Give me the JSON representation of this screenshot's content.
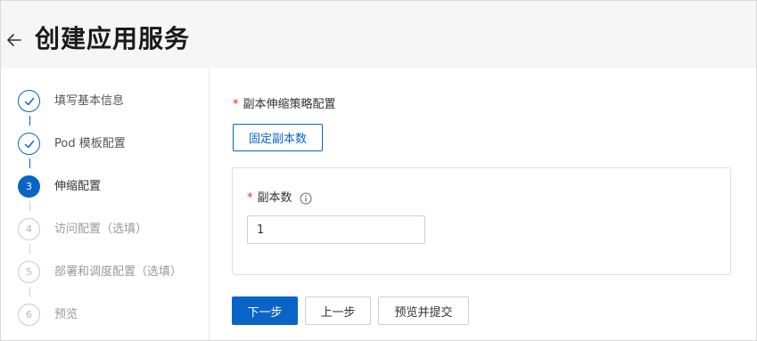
{
  "header": {
    "title": "创建应用服务"
  },
  "steps": [
    {
      "number": "1",
      "label": "填写基本信息",
      "state": "done"
    },
    {
      "number": "2",
      "label": "Pod 模板配置",
      "state": "done"
    },
    {
      "number": "3",
      "label": "伸缩配置",
      "state": "active"
    },
    {
      "number": "4",
      "label": "访问配置（选填）",
      "state": "todo"
    },
    {
      "number": "5",
      "label": "部署和调度配置（选填）",
      "state": "todo"
    },
    {
      "number": "6",
      "label": "预览",
      "state": "todo"
    }
  ],
  "scaling": {
    "required_mark": "*",
    "section_title": "副本伸缩策略配置",
    "policy_option": "固定副本数",
    "replicas_label": "副本数",
    "replicas_value": "1"
  },
  "actions": {
    "next": "下一步",
    "prev": "上一步",
    "preview_submit": "预览并提交"
  },
  "colors": {
    "accent": "#0a64c8",
    "required": "#d93026"
  },
  "icons": {
    "back": "arrow-left-icon",
    "done": "check-icon",
    "info": "info-icon"
  }
}
